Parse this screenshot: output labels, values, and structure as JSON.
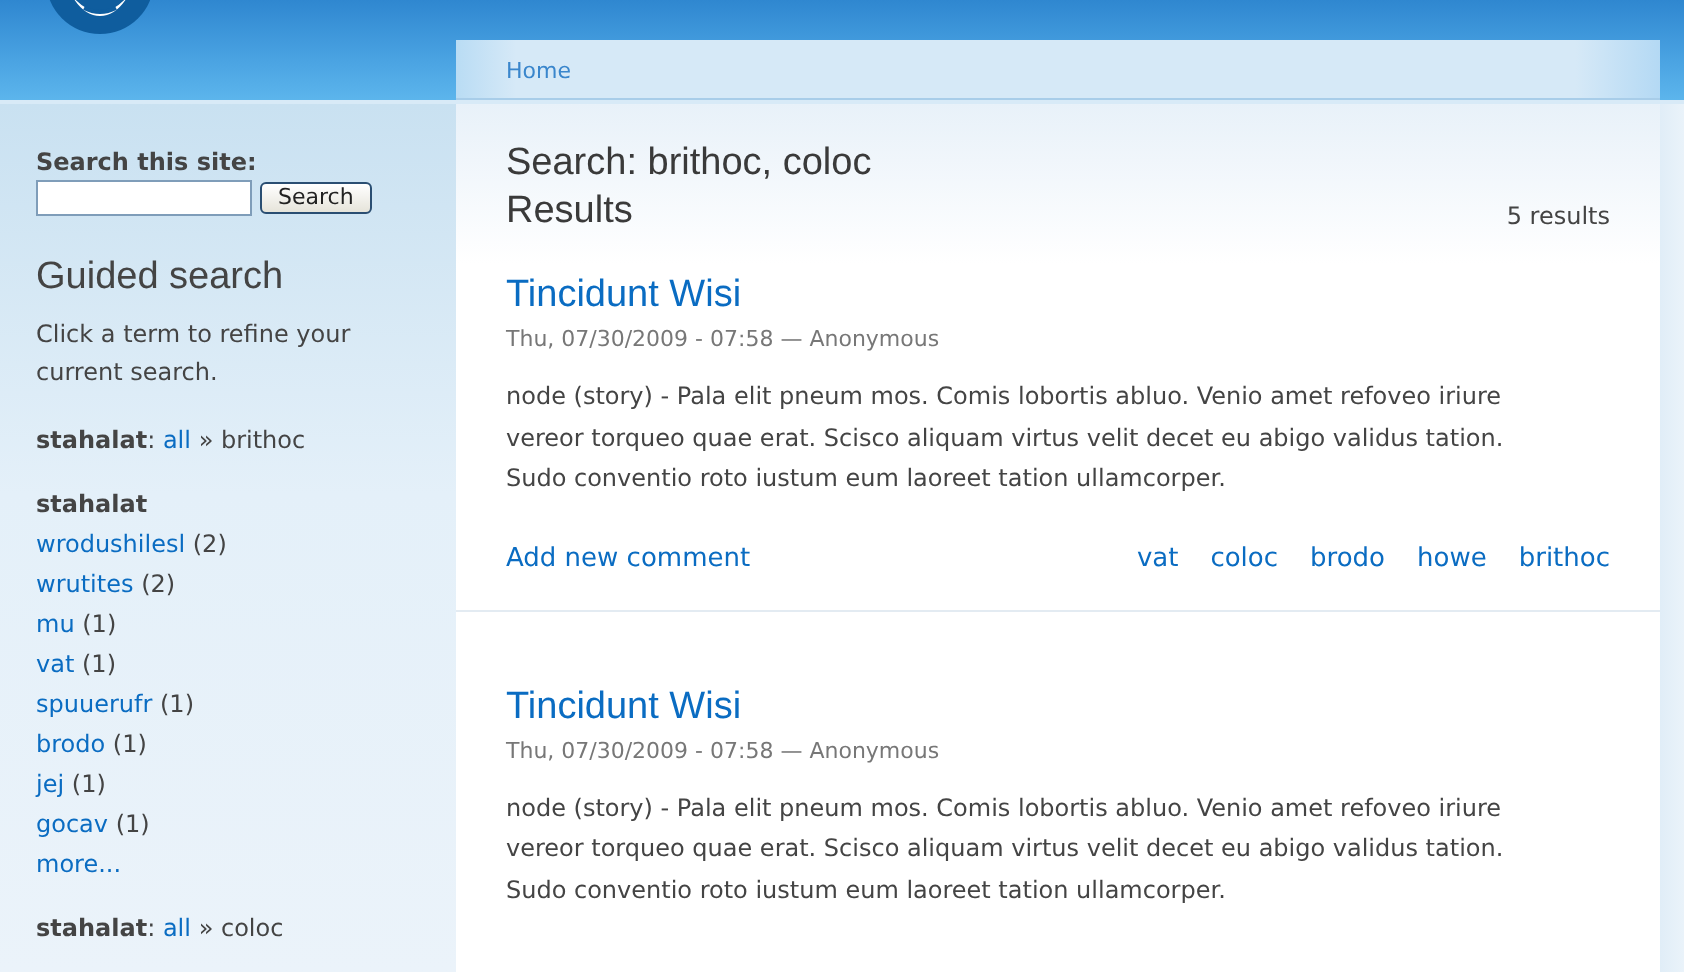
{
  "breadcrumb": {
    "label": "Home"
  },
  "sidebar": {
    "search": {
      "label": "Search this site:",
      "button": "Search"
    },
    "guided_search": {
      "title": "Guided search",
      "intro": "Click a term to refine your current search.",
      "facets": [
        {
          "kind": "current",
          "label": "**stahalat**:",
          "link": "all",
          "rest": "» brithoc"
        },
        {
          "kind": "list",
          "heading": "stahalat",
          "more": "more...",
          "items": [
            {
              "term": "wrodushilesl",
              "count": "(2)"
            },
            {
              "term": "wrutites",
              "count": "(2)"
            },
            {
              "term": "mu",
              "count": "(1)"
            },
            {
              "term": "vat",
              "count": "(1)"
            },
            {
              "term": "spuuerufr",
              "count": "(1)"
            },
            {
              "term": "brodo",
              "count": "(1)"
            },
            {
              "term": "jej",
              "count": "(1)"
            },
            {
              "term": "gocav",
              "count": "(1)"
            }
          ]
        },
        {
          "kind": "current",
          "label": "**stahalat**:",
          "link": "all",
          "rest": "» coloc"
        }
      ]
    }
  },
  "main": {
    "title": "Search: brithoc, coloc",
    "subtitle": "Results",
    "count": "5 results",
    "results": [
      {
        "title": "Tincidunt Wisi",
        "meta": "Thu, 07/30/2009 - 07:58 — Anonymous",
        "body": "node (story) - Pala elit pneum mos. Comis lobortis abluo. Venio amet refoveo iriure vereor torqueo quae erat. Scisco aliquam virtus velit decet eu abigo validus tation. Sudo conventio roto iustum eum laoreet tation ullamcorper.",
        "comment_link": "Add new comment",
        "tags": [
          "vat",
          "coloc",
          "brodo",
          "howe",
          "brithoc"
        ]
      },
      {
        "title": "Tincidunt Wisi",
        "meta": "Thu, 07/30/2009 - 07:58 — Anonymous",
        "body": "node (story) - Pala elit pneum mos. Comis lobortis abluo. Venio amet refoveo iriure vereor torqueo quae erat. Scisco aliquam virtus velit decet eu abigo validus tation. Sudo conventio roto iustum eum laoreet tation ullamcorper."
      }
    ]
  }
}
